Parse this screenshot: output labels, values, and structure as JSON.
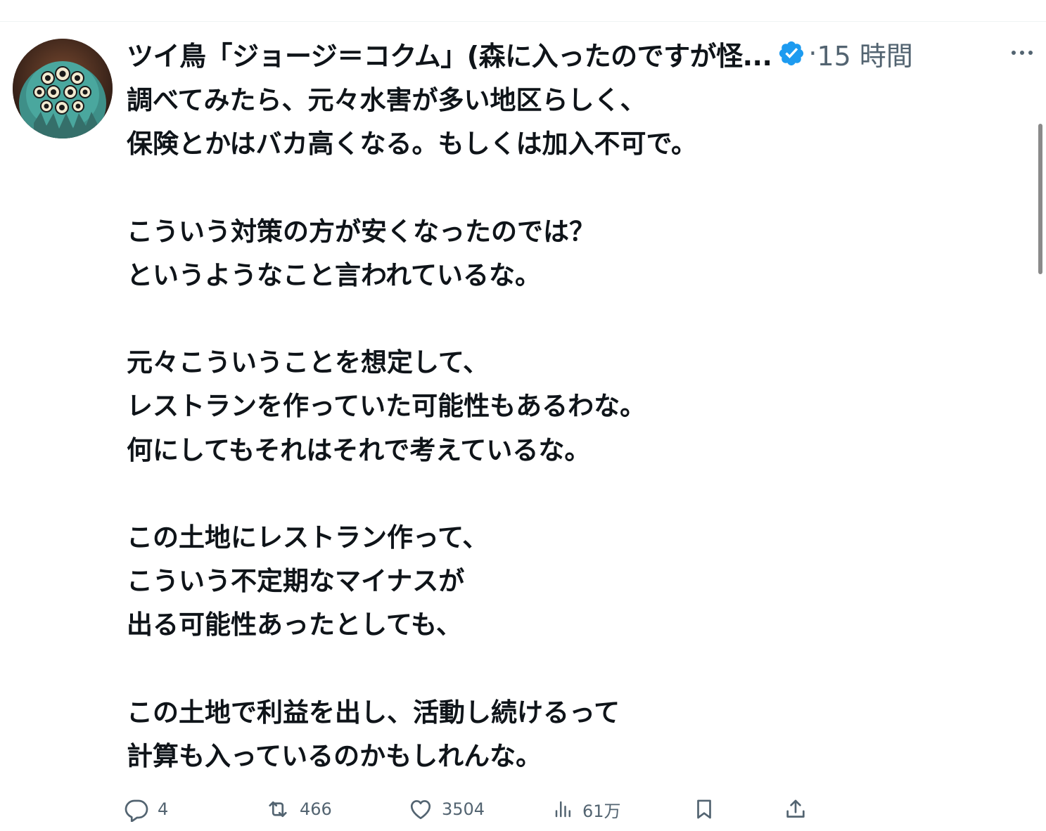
{
  "tweet": {
    "author_name": "ツイ鳥「ジョージ＝コクム」(森に入ったのですが怪...",
    "verified_icon": "verified-badge-icon",
    "separator": "·",
    "time": "15 時間",
    "more_icon": "more-options-icon",
    "lines": [
      "調べてみたら、元々水害が多い地区らしく、",
      "保険とかはバカ高くなる。もしくは加入不可で。",
      "",
      "こういう対策の方が安くなったのでは？",
      "というようなこと言われているな。",
      "",
      "元々こういうことを想定して、",
      "レストランを作っていた可能性もあるわな。",
      "何にしてもそれはそれで考えているな。",
      "",
      "この土地にレストラン作って、",
      "こういう不定期なマイナスが",
      "出る可能性あったとしても、",
      "",
      "この土地で利益を出し、活動し続けるって",
      "計算も入っているのかもしれんな。"
    ]
  },
  "actions": {
    "reply": {
      "icon": "reply-icon",
      "count": "4"
    },
    "retweet": {
      "icon": "retweet-icon",
      "count": "466"
    },
    "like": {
      "icon": "heart-icon",
      "count": "3504"
    },
    "views": {
      "icon": "views-chart-icon",
      "count": "61万"
    },
    "bookmark": {
      "icon": "bookmark-icon"
    },
    "share": {
      "icon": "share-icon"
    }
  },
  "colors": {
    "text_primary": "#0f1419",
    "text_secondary": "#536471",
    "verified_blue": "#1d9bf0"
  }
}
